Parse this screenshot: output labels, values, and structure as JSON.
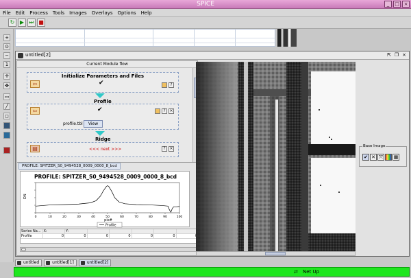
{
  "window": {
    "title": "SPICE"
  },
  "menu": [
    "File",
    "Edit",
    "Process",
    "Tools",
    "Images",
    "Overlays",
    "Options",
    "Help"
  ],
  "inner_window": {
    "title": "untitled[2]"
  },
  "module_flow": {
    "header": "Current Module flow",
    "steps": [
      {
        "name": "Initialize Parameters and Files"
      },
      {
        "name": "Profile",
        "file": "profile.tbl",
        "view_label": "View"
      },
      {
        "name": "Ridge",
        "next_label": "<<< next >>>"
      }
    ]
  },
  "profile_panel": {
    "tab_label": "PROFILE: SPITZER_S0_9494528_0009_0000_8_bcd",
    "plot_title": "PROFILE: SPITZER_S0_9494528_0009_0000_8_bcd",
    "ylabel": "DN",
    "xlabel": "pix#",
    "legend": "Profile",
    "table": {
      "headers": [
        "Series Na...",
        "X:",
        "Y:",
        "",
        "",
        "",
        "",
        ""
      ],
      "rows": [
        [
          "Profile",
          "0",
          "0",
          "0",
          "0",
          "0",
          "0",
          "0"
        ]
      ]
    }
  },
  "chart_data": {
    "type": "line",
    "title": "PROFILE: SPITZER_S0_9494528_0009_0000_8_bcd",
    "xlabel": "pix#",
    "ylabel": "DN",
    "xlim": [
      0,
      100
    ],
    "ylim": [
      0,
      100
    ],
    "xticks": [
      0,
      10,
      20,
      30,
      40,
      50,
      60,
      70,
      80,
      90,
      100
    ],
    "yticks": [
      0,
      25,
      50,
      75,
      100
    ],
    "series": [
      {
        "name": "Profile",
        "x": [
          0,
          10,
          20,
          30,
          38,
          42,
          45,
          47,
          49,
          50,
          51,
          53,
          55,
          58,
          62,
          70,
          80,
          88,
          92,
          93,
          94,
          95,
          96,
          98,
          100
        ],
        "y": [
          22,
          26,
          27,
          29,
          33,
          40,
          55,
          72,
          86,
          90,
          86,
          70,
          50,
          36,
          30,
          27,
          26,
          24,
          22,
          10,
          2,
          14,
          20,
          20,
          21
        ]
      }
    ]
  },
  "base_image": {
    "label": "Base Image",
    "buttons": [
      "check-icon",
      "close-icon",
      "fit-icon",
      "colormap-icon",
      "grid-icon"
    ]
  },
  "dock_tabs": [
    {
      "label": "untitled",
      "active": false
    },
    {
      "label": "untitled[1]",
      "active": false
    },
    {
      "label": "untitled[2]",
      "active": true
    }
  ],
  "status": {
    "text": "Net Up",
    "color": "#1ee61e"
  },
  "colors": {
    "titlebar": "#c87ab8",
    "flow_arrow": "#30c8c8",
    "next_label": "#cc0000"
  }
}
